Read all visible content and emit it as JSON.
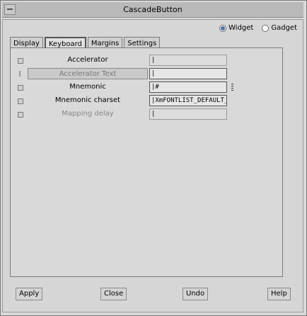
{
  "window": {
    "title": "CascadeButton"
  },
  "kind_selector": {
    "options": [
      {
        "label": "Widget",
        "selected": true
      },
      {
        "label": "Gadget",
        "selected": false
      }
    ]
  },
  "tabs": [
    "Display",
    "Keyboard",
    "Margins",
    "Settings"
  ],
  "active_tab": "Keyboard",
  "rows": [
    {
      "label": "Accelerator",
      "value": "|",
      "style": "normal"
    },
    {
      "label": "Accelerator Text",
      "value": "|",
      "style": "button"
    },
    {
      "label": "Mnemonic",
      "value": "|#",
      "style": "normal"
    },
    {
      "label": "Mnemonic charset",
      "value": "|XmFONTLIST_DEFAULT_TA",
      "style": "normal"
    },
    {
      "label": "Mapping delay",
      "value": "|",
      "style": "dim"
    }
  ],
  "buttons": {
    "apply": "Apply",
    "close": "Close",
    "undo": "Undo",
    "help": "Help"
  }
}
